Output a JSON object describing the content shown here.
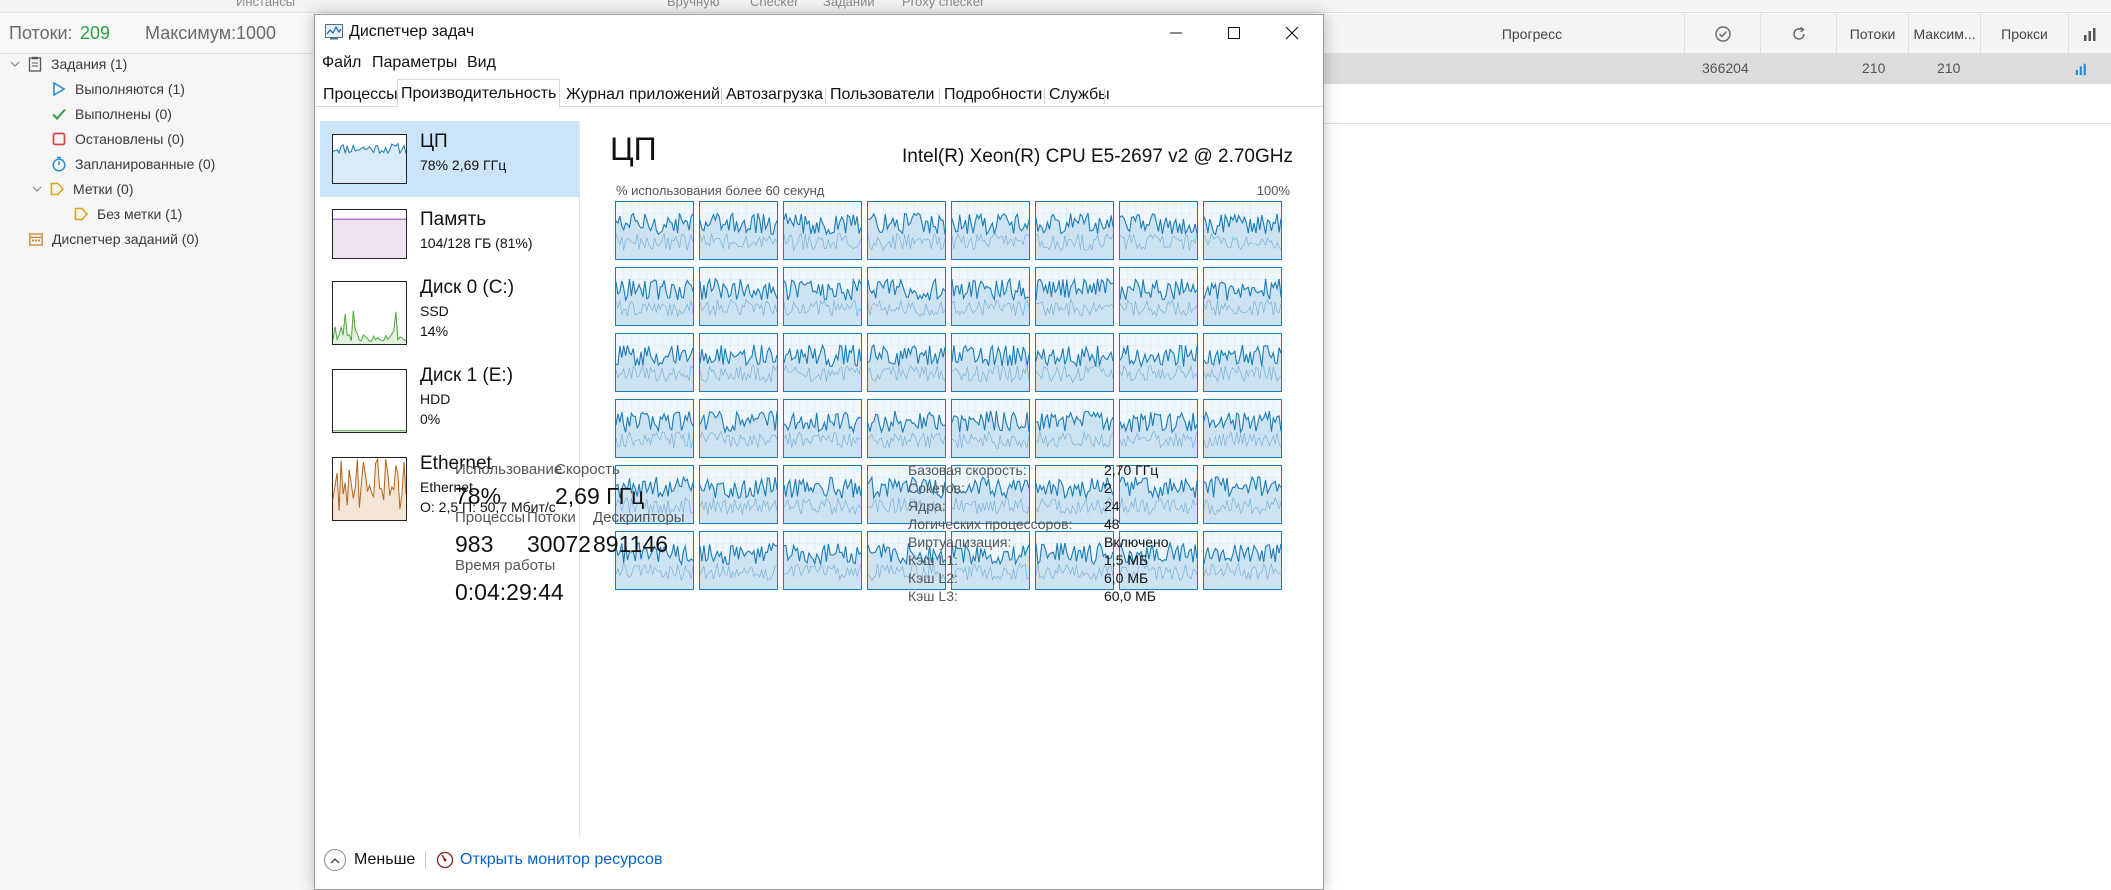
{
  "background_app": {
    "top_strip": [
      "Инстансы",
      "Вручную",
      "Checker",
      "Заданий",
      "Proxy checker"
    ],
    "threads_label": "Потоки:",
    "threads_value": "209",
    "max_label": "Максимум:",
    "max_value": "1000",
    "tree": [
      {
        "label": "Задания (1)",
        "icon": "clipboard-icon",
        "color": "#555555"
      },
      {
        "label": "Выполняются (1)",
        "icon": "play-icon",
        "color": "#2a8ad4"
      },
      {
        "label": "Выполнены (0)",
        "icon": "check-icon",
        "color": "#2ea043"
      },
      {
        "label": "Остановлены (0)",
        "icon": "stop-icon",
        "color": "#d64545"
      },
      {
        "label": "Запланированные (0)",
        "icon": "timer-icon",
        "color": "#2a8ad4"
      },
      {
        "label": "Метки (0)",
        "icon": "tag-icon",
        "color": "#e0a020"
      },
      {
        "label": "Без метки (1)",
        "icon": "tag-icon",
        "color": "#e0a020"
      },
      {
        "label": "Диспетчер заданий (0)",
        "icon": "calendar-icon",
        "color": "#d08a3a"
      }
    ],
    "columns": {
      "progress": "Прогресс",
      "threads": "Потоки",
      "max": "Максим...",
      "proxies": "Прокси"
    },
    "row": {
      "count": "366204",
      "threads": "210",
      "max": "210"
    }
  },
  "window": {
    "title": "Диспетчер задач",
    "menu": [
      "Файл",
      "Параметры",
      "Вид"
    ],
    "tabs": [
      "Процессы",
      "Производительность",
      "Журнал приложений",
      "Автозагрузка",
      "Пользователи",
      "Подробности",
      "Службы"
    ],
    "active_tab": "Производительность"
  },
  "perf_list": [
    {
      "title": "ЦП",
      "sub1": "78% 2,69 ГГц",
      "sub2": "",
      "sub3": "",
      "color": "#1a7cb8",
      "selected": true
    },
    {
      "title": "Память",
      "sub1": "104/128 ГБ (81%)",
      "sub2": "",
      "sub3": "",
      "color": "#8b3fa8",
      "selected": false
    },
    {
      "title": "Диск 0 (C:)",
      "sub1": "SSD",
      "sub2": "14%",
      "sub3": "",
      "color": "#4da63b",
      "selected": false
    },
    {
      "title": "Диск 1 (E:)",
      "sub1": "HDD",
      "sub2": "0%",
      "sub3": "",
      "color": "#4da63b",
      "selected": false
    },
    {
      "title": "Ethernet",
      "sub1": "Ethernet",
      "sub2": "О: 2,5 П: 50,7 Мбит/с",
      "sub3": "",
      "color": "#b5651d",
      "selected": false
    }
  ],
  "cpu": {
    "title": "ЦП",
    "model": "Intel(R) Xeon(R) CPU E5-2697 v2 @ 2.70GHz",
    "graph_label": "% использования более 60 секунд",
    "graph_max": "100%",
    "logical_processor_graphs": 48,
    "graph_color": "#1a7cb8",
    "stats": {
      "usage_label": "Использование",
      "usage_value": "78%",
      "speed_label": "Скорость",
      "speed_value": "2,69 ГГц",
      "processes_label": "Процессы",
      "processes_value": "983",
      "threads_label": "Потоки",
      "threads_value": "30072",
      "handles_label": "Дескрипторы",
      "handles_value": "891146",
      "uptime_label": "Время работы",
      "uptime_value": "0:04:29:44"
    },
    "details": [
      {
        "key": "Базовая скорость:",
        "value": "2,70 ГГц"
      },
      {
        "key": "Сокетов:",
        "value": "2"
      },
      {
        "key": "Ядра:",
        "value": "24"
      },
      {
        "key": "Логических процессоров:",
        "value": "48"
      },
      {
        "key": "Виртуализация:",
        "value": "Включено"
      },
      {
        "key": "Кэш L1:",
        "value": "1,5 МБ"
      },
      {
        "key": "Кэш L2:",
        "value": "6,0 МБ"
      },
      {
        "key": "Кэш L3:",
        "value": "60,0 МБ"
      }
    ]
  },
  "footer": {
    "less_label": "Меньше",
    "resource_monitor_label": "Открыть монитор ресурсов"
  }
}
